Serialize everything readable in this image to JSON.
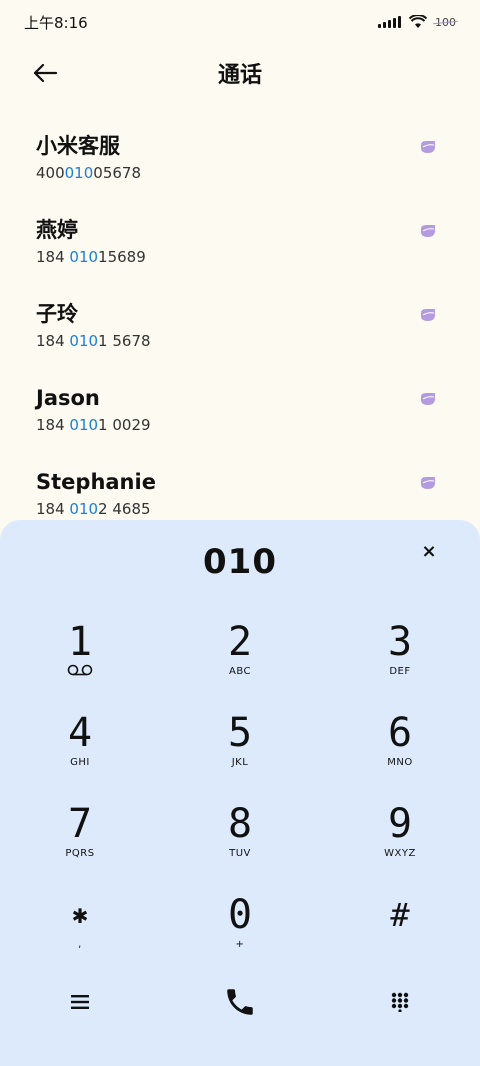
{
  "status_bar": {
    "time": "上午8:16",
    "battery": "100"
  },
  "header": {
    "title": "通话"
  },
  "contacts": [
    {
      "name": "小米客服",
      "number_parts": [
        "400",
        "010",
        "05678"
      ]
    },
    {
      "name": "燕婷",
      "number_parts": [
        "184 ",
        "010",
        "15689"
      ]
    },
    {
      "name": "子玲",
      "number_parts": [
        "184 ",
        "010",
        "1 5678"
      ]
    },
    {
      "name": "Jason",
      "number_parts": [
        "184 ",
        "010",
        "1 0029"
      ]
    },
    {
      "name": "Stephanie",
      "number_parts": [
        "184 ",
        "010",
        "2 4685"
      ]
    }
  ],
  "dialer": {
    "entered_number": "010",
    "clear_label": "×",
    "keys": [
      {
        "digit": "1",
        "letters": ""
      },
      {
        "digit": "2",
        "letters": "ABC"
      },
      {
        "digit": "3",
        "letters": "DEF"
      },
      {
        "digit": "4",
        "letters": "GHI"
      },
      {
        "digit": "5",
        "letters": "JKL"
      },
      {
        "digit": "6",
        "letters": "MNO"
      },
      {
        "digit": "7",
        "letters": "PQRS"
      },
      {
        "digit": "8",
        "letters": "TUV"
      },
      {
        "digit": "9",
        "letters": "WXYZ"
      },
      {
        "digit": "✱",
        "letters": ","
      },
      {
        "digit": "0",
        "letters": "+"
      },
      {
        "digit": "#",
        "letters": ""
      }
    ]
  },
  "icons": {
    "back": "arrow-left-icon",
    "sim": "sim-card-icon",
    "voicemail": "voicemail-icon",
    "menu": "menu-icon",
    "call": "phone-icon",
    "keypad_toggle": "dialpad-icon"
  },
  "colors": {
    "background": "#fdfaf2",
    "dialpad_background": "#ddeafb",
    "highlight": "#1a7fd8",
    "sim_icon": "#b49be0"
  }
}
